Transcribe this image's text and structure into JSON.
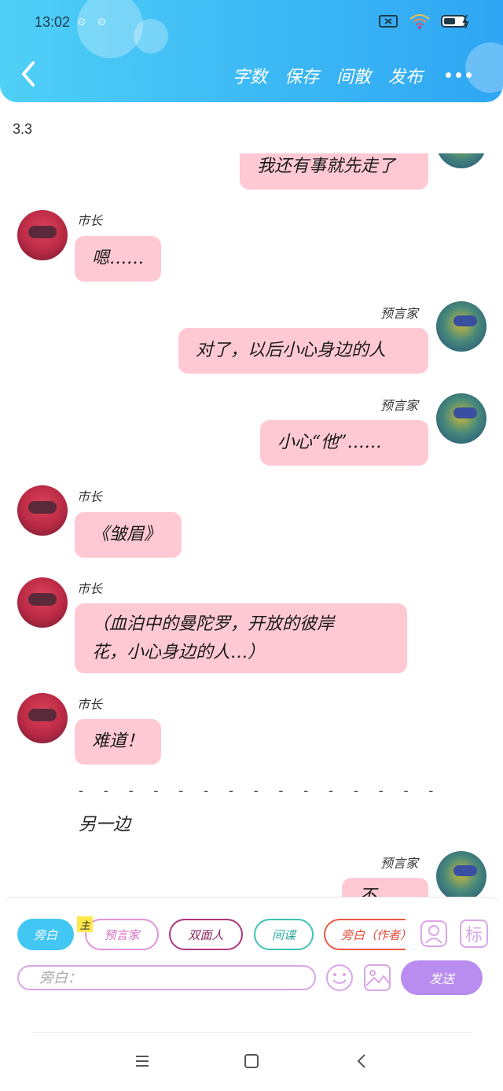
{
  "status": {
    "time": "13:02"
  },
  "header": {
    "actions": [
      "字数",
      "保存",
      "间散",
      "发布"
    ]
  },
  "chapter_label": "3.3",
  "messages": [
    {
      "side": "right",
      "speaker": "",
      "text": "我还有事就先走了"
    },
    {
      "side": "left",
      "speaker": "市长",
      "text": "嗯……"
    },
    {
      "side": "right",
      "speaker": "预言家",
      "text": "对了，以后小心身边的人"
    },
    {
      "side": "right",
      "speaker": "预言家",
      "text": "小心“他”……"
    },
    {
      "side": "left",
      "speaker": "市长",
      "text": "《皱眉》"
    },
    {
      "side": "left",
      "speaker": "市长",
      "text_line1": "（血泊中的曼陀罗，开放的彼岸",
      "text_line2": "花，小心身边的人…）"
    },
    {
      "side": "left",
      "speaker": "市长",
      "text": "难道！"
    },
    {
      "side": "right",
      "speaker": "预言家",
      "text": "不要……"
    }
  ],
  "divider": "- - - - - - - - - - - - - - -",
  "narration": "另一边",
  "composer": {
    "roles": [
      "旁白",
      "预言家",
      "双面人",
      "间谍",
      "旁白（作者）"
    ],
    "lead_tag": "主",
    "input_placeholder": "旁白：",
    "send_label": "发送",
    "mark_label": "标"
  },
  "colors": {
    "header_gradient_start": "#4fd0f6",
    "header_gradient_end": "#2fa6f3",
    "bubble": "#ffc9d4",
    "send": "#b98cf0"
  }
}
